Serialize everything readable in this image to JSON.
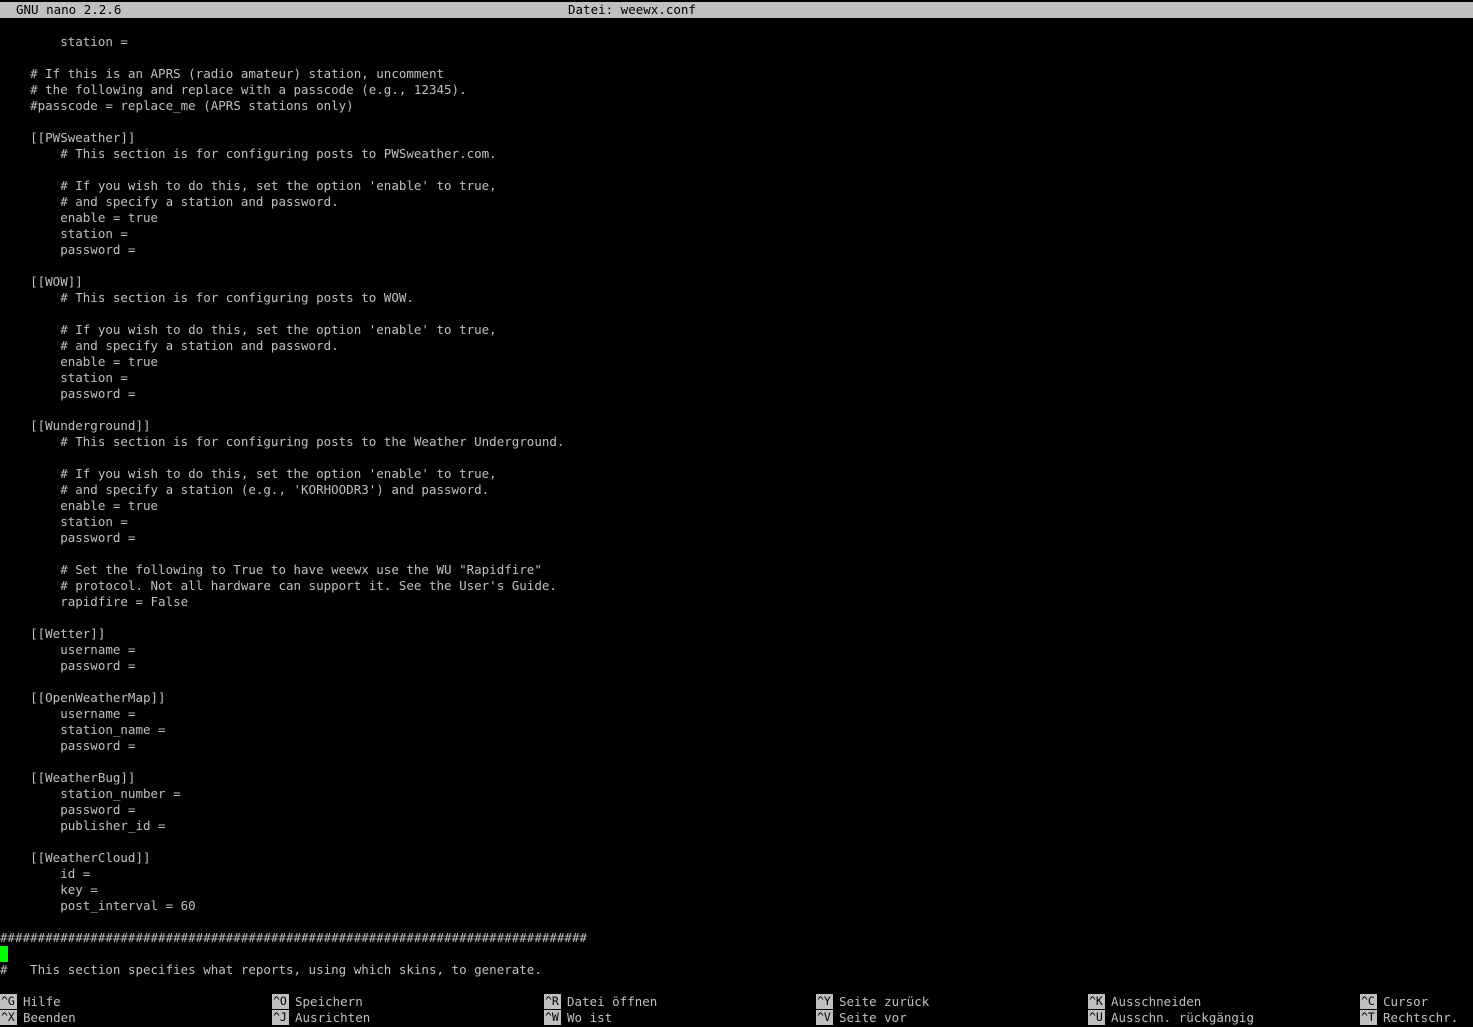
{
  "window": {
    "app_name": "GNU nano 2.2.6",
    "file_title": "Datei: weewx.conf"
  },
  "editor": {
    "lines": [
      "        station =",
      "",
      "    # If this is an APRS (radio amateur) station, uncomment",
      "    # the following and replace with a passcode (e.g., 12345).",
      "    #passcode = replace_me (APRS stations only)",
      "",
      "    [[PWSweather]]",
      "        # This section is for configuring posts to PWSweather.com.",
      "",
      "        # If you wish to do this, set the option 'enable' to true,",
      "        # and specify a station and password.",
      "        enable = true",
      "        station =",
      "        password =",
      "",
      "    [[WOW]]",
      "        # This section is for configuring posts to WOW.",
      "",
      "        # If you wish to do this, set the option 'enable' to true,",
      "        # and specify a station and password.",
      "        enable = true",
      "        station =",
      "        password =",
      "",
      "    [[Wunderground]]",
      "        # This section is for configuring posts to the Weather Underground.",
      "",
      "        # If you wish to do this, set the option 'enable' to true,",
      "        # and specify a station (e.g., 'KORHOODR3') and password.",
      "        enable = true",
      "        station =",
      "        password =",
      "",
      "        # Set the following to True to have weewx use the WU \"Rapidfire\"",
      "        # protocol. Not all hardware can support it. See the User's Guide.",
      "        rapidfire = False",
      "",
      "    [[Wetter]]",
      "        username =",
      "        password =",
      "",
      "    [[OpenWeatherMap]]",
      "        username =",
      "        station_name =",
      "        password =",
      "",
      "    [[WeatherBug]]",
      "        station_number =",
      "        password =",
      "        publisher_id =",
      "",
      "    [[WeatherCloud]]",
      "        id =",
      "        key =",
      "        post_interval = 60",
      "",
      "##############################################################################",
      "",
      "#   This section specifies what reports, using which skins, to generate."
    ]
  },
  "shortcuts": [
    {
      "key": "^G",
      "label": "Hilfe"
    },
    {
      "key": "^X",
      "label": "Beenden"
    },
    {
      "key": "^O",
      "label": "Speichern"
    },
    {
      "key": "^J",
      "label": "Ausrichten"
    },
    {
      "key": "^R",
      "label": "Datei öffnen"
    },
    {
      "key": "^W",
      "label": "Wo ist"
    },
    {
      "key": "^Y",
      "label": "Seite zurück"
    },
    {
      "key": "^V",
      "label": "Seite vor"
    },
    {
      "key": "^K",
      "label": "Ausschneiden"
    },
    {
      "key": "^U",
      "label": "Ausschn. rückgängig"
    },
    {
      "key": "^C",
      "label": "Cursor"
    },
    {
      "key": "^T",
      "label": "Rechtschr."
    }
  ],
  "colors": {
    "background": "#000000",
    "text": "#c0c0c0",
    "inverse_bar": "#c0c0c0",
    "cursor": "#00ff00"
  }
}
